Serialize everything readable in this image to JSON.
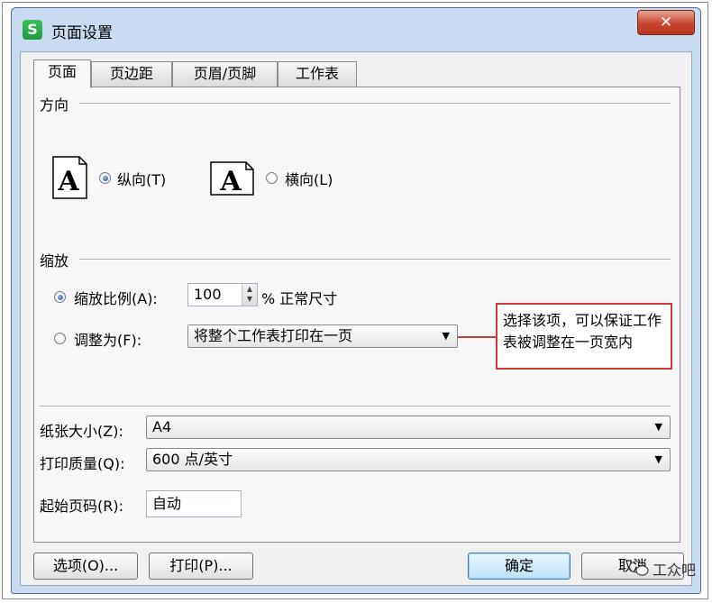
{
  "window": {
    "title": "页面设置",
    "close_label": "✕",
    "app_logo_letter": "S"
  },
  "tabs": [
    {
      "label": "页面",
      "active": true
    },
    {
      "label": "页边距",
      "active": false
    },
    {
      "label": "页眉/页脚",
      "active": false
    },
    {
      "label": "工作表",
      "active": false
    }
  ],
  "orientation": {
    "section_label": "方向",
    "icon_letter": "A",
    "portrait": {
      "label": "纵向(T)",
      "checked": true
    },
    "landscape": {
      "label": "横向(L)",
      "checked": false
    }
  },
  "scaling": {
    "section_label": "缩放",
    "scale": {
      "label": "缩放比例(A):",
      "value": "100",
      "unit": "% 正常尺寸",
      "checked": true
    },
    "fit": {
      "label": "调整为(F):",
      "selected": "将整个工作表打印在一页",
      "checked": false
    },
    "callout": "选择该项，可以保证工作表被调整在一页宽内"
  },
  "paper": {
    "size_label": "纸张大小(Z):",
    "size_value": "A4",
    "quality_label": "打印质量(Q):",
    "quality_value": "600 点/英寸",
    "first_page_label": "起始页码(R):",
    "first_page_value": "自动"
  },
  "buttons": {
    "options": "选项(O)...",
    "print": "打印(P)...",
    "ok": "确定",
    "cancel": "取消"
  },
  "watermark": {
    "text": "工众吧"
  },
  "colors": {
    "accent_red": "#d23a3a",
    "logo_green": "#1f9a3e",
    "close_red": "#c9452e"
  }
}
